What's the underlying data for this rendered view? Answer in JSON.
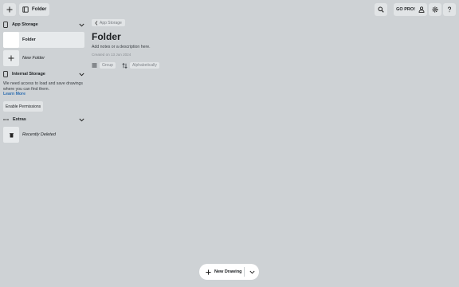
{
  "toolbar": {
    "folder_label": "Folder",
    "go_pro_label": "GO PRO!"
  },
  "sidebar": {
    "app_storage": {
      "title": "App Storage",
      "items": [
        {
          "label": "Folder"
        },
        {
          "label": "New Folder"
        }
      ]
    },
    "internal_storage": {
      "title": "Internal Storage",
      "message": "We need access to load and save drawings where you can find them.",
      "learn_more": "Learn More",
      "button": "Enable Permissions"
    },
    "extras": {
      "title": "Extras",
      "items": [
        {
          "label": "Recently Deleted"
        }
      ]
    }
  },
  "main": {
    "breadcrumb": "App Storage",
    "title": "Folder",
    "description": "Add notes or a description here.",
    "created": "Created on 13 Jun 2024",
    "group_label": "Group",
    "sort_label": "Alphabetically"
  },
  "fab": {
    "label": "New Drawing"
  }
}
